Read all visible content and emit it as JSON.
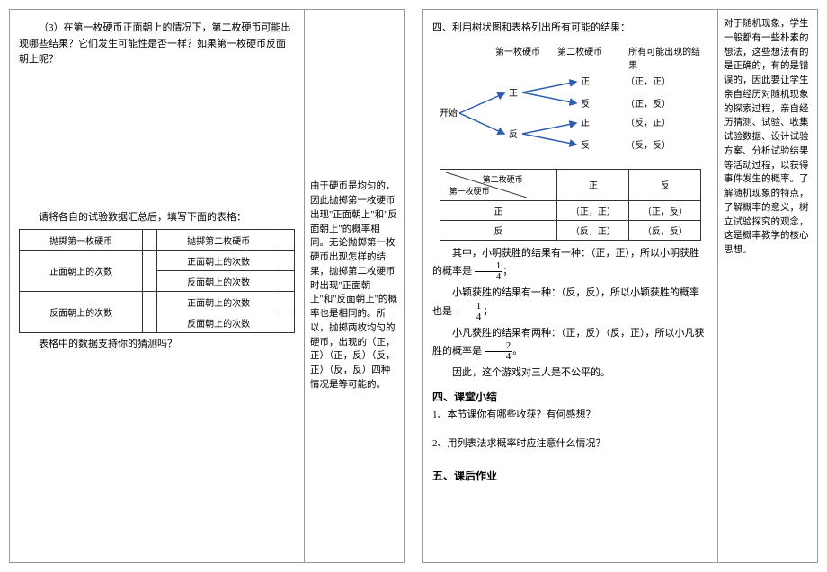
{
  "left": {
    "q3": "（3）在第一枚硬币正面朝上的情况下，第二枚硬币可能出现哪些结果？它们发生可能性是否一样？如果第一枚硬币反面朝上呢？",
    "tableIntro": "请将各自的试验数据汇总后，填写下面的表格：",
    "table": {
      "h1": "抛掷第一枚硬币",
      "h2": "抛掷第二枚硬币",
      "r1c1": "正面朝上的次数",
      "r1c2": "正面朝上的次数",
      "r2c2": "反面朝上的次数",
      "r3c1": "反面朝上的次数",
      "r3c2": "正面朝上的次数",
      "r4c2": "反面朝上的次数"
    },
    "afterTable": "表格中的数据支持你的猜测吗？",
    "side": "由于硬币是均匀的，因此抛掷第一枚硬币出现\"正面朝上\"和\"反面朝上\"的概率相同。无论抛掷第一枚硬币出现怎样的结果，抛掷第二枚硬币时出现\"正面朝上\"和\"反面朝上\"的概率也是相同的。所以，抛掷两枚均匀的硬币，出现的（正，正）（正，反）（反，正）（反，反）四种情况是等可能的。"
  },
  "right": {
    "treeTitle": "四、利用树状图和表格列出所有可能的结果：",
    "treeHead": {
      "c1": "第一枚硬币",
      "c2": "第二枚硬币",
      "c3": "所有可能出现的结果"
    },
    "tree": {
      "start": "开始",
      "zheng": "正",
      "fan": "反",
      "r1": "（正，正）",
      "r2": "（正，反）",
      "r3": "（反，正）",
      "r4": "（反，反）"
    },
    "resultTable": {
      "diagTop": "第二枚硬币",
      "diagBottom": "第一枚硬币",
      "colZ": "正",
      "colF": "反",
      "rowZ": "正",
      "rowF": "反",
      "zz": "（正，正）",
      "zf": "（正，反）",
      "fz": "（反，正）",
      "ff": "（反，反）"
    },
    "p_ming_a": "其中，小明获胜的结果有一种：（正，正），所以小明获胜的概率是",
    "frac14": {
      "num": "1",
      "den": "4"
    },
    "p_ming_b": "；",
    "p_ying_a": "小颖获胜的结果有一种：（反，反），所以小颖获胜的概率也是",
    "p_ying_b": "；",
    "p_fan_a": "小凡获胜的结果有两种：（正，反）（反，正），所以小凡获胜的概率是",
    "frac24": {
      "num": "2",
      "den": "4"
    },
    "p_fan_b": "。",
    "conclusion": "因此，这个游戏对三人是不公平的。",
    "section4": "四、课堂小结",
    "q4_1": "1、本节课你有哪些收获？有何感想？",
    "q4_2": "2、用列表法求概率时应注意什么情况？",
    "section5": "五、课后作业",
    "side": "对于随机现象，学生一般都有一些朴素的想法，这些想法有的是正确的，有的是错误的，因此要让学生亲自经历对随机现象的探索过程，亲自经历猜测、试验、收集试验数据、设计试验方案、分析试验结果等活动过程，以获得事件发生的概率。了解随机现象的特点，了解概率的意义，树立试验探究的观念，这是概率教学的核心思想。"
  }
}
